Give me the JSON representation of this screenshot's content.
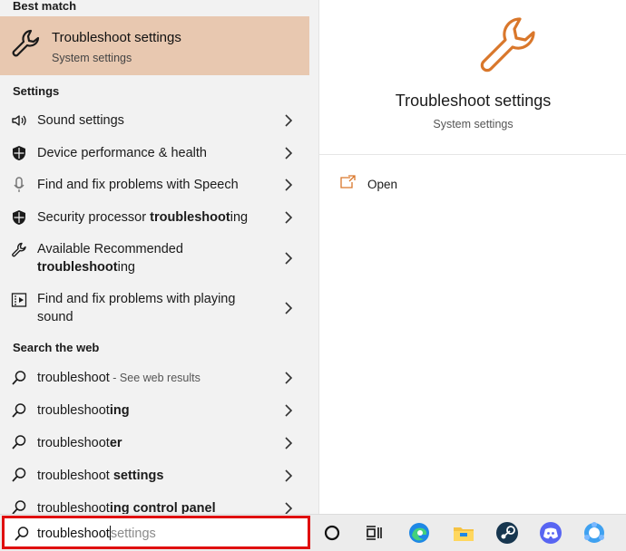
{
  "best_match": {
    "header": "Best match",
    "title": "Troubleshoot settings",
    "subtitle": "System settings",
    "icon": "wrench-icon",
    "highlight_color": "#e8c8b0"
  },
  "settings_section": {
    "header": "Settings",
    "items": [
      {
        "icon": "speaker-icon",
        "label_plain": "Sound settings",
        "label_bold": "",
        "label_tail": ""
      },
      {
        "icon": "shield-icon",
        "label_plain": "Device performance & health",
        "label_bold": "",
        "label_tail": ""
      },
      {
        "icon": "microphone-icon",
        "label_plain": "Find and fix problems with Speech",
        "label_bold": "",
        "label_tail": ""
      },
      {
        "icon": "shield-icon",
        "label_plain": "Security processor ",
        "label_bold": "troubleshoot",
        "label_tail": "ing"
      },
      {
        "icon": "wrench-icon",
        "line1": "Available Recommended",
        "line2_bold": "troubleshoot",
        "line2_tail": "ing"
      },
      {
        "icon": "video-icon",
        "line1": "Find and fix problems with playing",
        "line2": "sound"
      }
    ]
  },
  "web_section": {
    "header": "Search the web",
    "items": [
      {
        "icon": "search-icon",
        "plain": "troubleshoot",
        "bold": "",
        "muted": " - See web results"
      },
      {
        "icon": "search-icon",
        "plain": "troubleshoot",
        "bold": "ing",
        "muted": ""
      },
      {
        "icon": "search-icon",
        "plain": "troubleshoot",
        "bold": "er",
        "muted": ""
      },
      {
        "icon": "search-icon",
        "plain": "troubleshoot ",
        "bold": "settings",
        "muted": ""
      },
      {
        "icon": "search-icon",
        "plain": "troubleshoot",
        "bold": "ing control panel",
        "muted": ""
      }
    ]
  },
  "preview": {
    "icon": "wrench-icon",
    "title": "Troubleshoot settings",
    "subtitle": "System settings",
    "open_label": "Open",
    "accent": "#d9772b"
  },
  "search": {
    "typed": "troubleshoot",
    "suggestion": "settings",
    "border_color": "#e00f0f"
  },
  "taskbar": {
    "icons": [
      "cortana-icon",
      "task-view-icon",
      "edge-icon",
      "file-explorer-icon",
      "steam-icon",
      "discord-icon",
      "app-icon"
    ]
  }
}
